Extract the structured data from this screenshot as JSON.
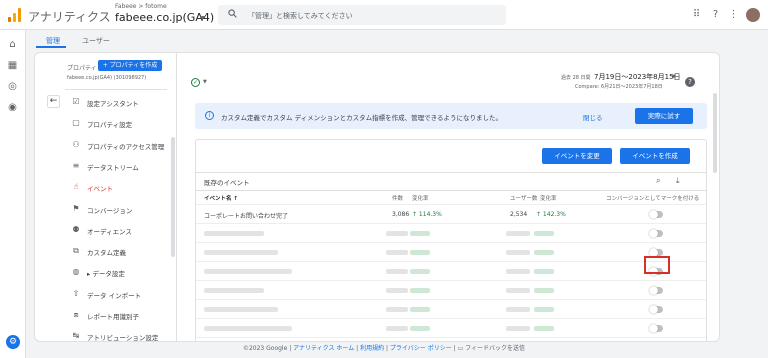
{
  "header": {
    "app_name": "アナリティクス",
    "breadcrumb": "Fabeee > fotome",
    "property": "fabeee.co.jp(GA4)",
    "search_placeholder": "「管理」と検索してみてください"
  },
  "tabs": [
    "管理",
    "ユーザー"
  ],
  "sidebar": {
    "property_label": "プロパティ",
    "create_button": "+ プロパティを作成",
    "account_line": "fabeee.co.jp(GA4) (301098927)",
    "items": [
      {
        "icon": "setup-assistant-icon",
        "label": "設定アシスタント"
      },
      {
        "icon": "property-settings-icon",
        "label": "プロパティ設定"
      },
      {
        "icon": "people-icon",
        "label": "プロパティのアクセス管理"
      },
      {
        "icon": "data-stream-icon",
        "label": "データストリーム"
      },
      {
        "icon": "event-icon",
        "label": "イベント"
      },
      {
        "icon": "flag-icon",
        "label": "コンバージョン"
      },
      {
        "icon": "audience-icon",
        "label": "オーディエンス"
      },
      {
        "icon": "custom-definitions-icon",
        "label": "カスタム定義"
      },
      {
        "icon": "database-icon",
        "label": "▸ データ設定"
      },
      {
        "icon": "upload-icon",
        "label": "データ インポート"
      },
      {
        "icon": "report-id-icon",
        "label": "レポート用識別子"
      },
      {
        "icon": "attribution-icon",
        "label": "アトリビューション設定"
      }
    ],
    "active_index": 4
  },
  "date": {
    "label": "過去 28 日間",
    "range": "7月19日～2023年8月15日",
    "compare": "Compare: 6月21日～2023年7月18日"
  },
  "banner": {
    "text": "カスタム定義でカスタム ディメンションとカスタム指標を作成、管理できるようになりました。",
    "close": "閉じる",
    "cta": "実際に試す"
  },
  "events": {
    "modify_button": "イベントを変更",
    "create_button": "イベントを作成",
    "title": "既存のイベント",
    "columns": {
      "name": "イベント名 ↑",
      "count": "件数",
      "count_change": "変化率",
      "users": "ユーザー数",
      "users_change": "変化率",
      "conversion": "コンバージョンとしてマークを付ける"
    },
    "first_row": {
      "name": "コーポレートお問い合わせ完了",
      "count": "3,086",
      "count_change": "↑ 114.3%",
      "users": "2,534",
      "users_change": "↑ 142.3%"
    },
    "hidden_rows": 7
  },
  "footer": {
    "copyright": "©2023 Google",
    "links": [
      "アナリティクス ホーム",
      "利用規約",
      "プライバシー ポリシー"
    ],
    "feedback": "フィードバックを送信"
  },
  "colors": {
    "accent": "#1a73e8",
    "active": "#d93025",
    "positive": "#188038"
  }
}
